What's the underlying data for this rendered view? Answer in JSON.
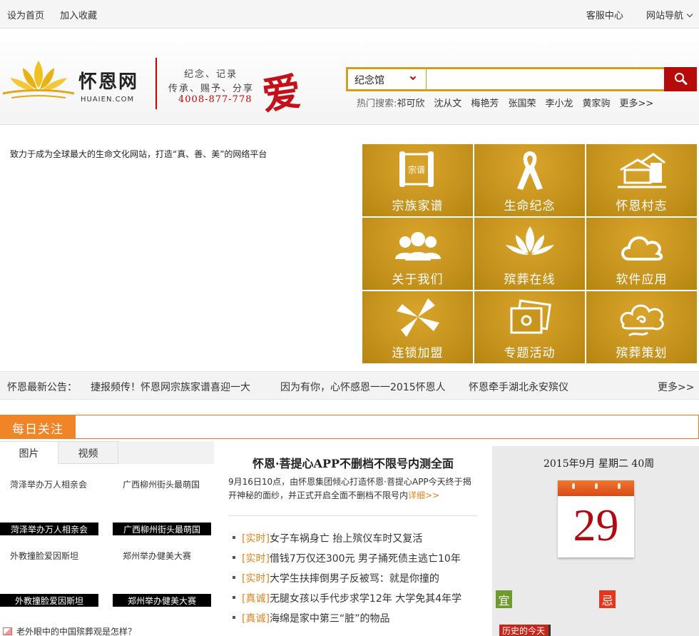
{
  "topbar": {
    "set_home": "设为首页",
    "add_fav": "加入收藏",
    "service": "客服中心",
    "site_nav": "网站导航"
  },
  "header": {
    "logo_cn": "怀恩网",
    "logo_en": "HUAIEN.COM",
    "slogan_line1": "纪念、记录",
    "slogan_line2": "传承、赐予、分享",
    "hotline": "4008-877-778",
    "love_char": "爱"
  },
  "search": {
    "category": "纪念馆",
    "value": "",
    "placeholder": "",
    "hot_label": "热门搜索:",
    "hot_keywords": [
      "祁可欣",
      "沈从文",
      "梅艳芳",
      "张国荣",
      "李小龙",
      "黄家驹",
      "更多>>"
    ]
  },
  "tagline": "致力于成为全球最大的生命文化网站，打造“真、善、美”的网络平台",
  "grid": [
    {
      "label": "宗族家谱",
      "icon": "scroll-icon"
    },
    {
      "label": "生命纪念",
      "icon": "ribbon-icon"
    },
    {
      "label": "怀恩村志",
      "icon": "village-icon"
    },
    {
      "label": "关于我们",
      "icon": "people-icon"
    },
    {
      "label": "殡葬在线",
      "icon": "lotus-icon"
    },
    {
      "label": "软件应用",
      "icon": "cloud-icon"
    },
    {
      "label": "连锁加盟",
      "icon": "pinwheel-icon"
    },
    {
      "label": "专题活动",
      "icon": "photo-icon"
    },
    {
      "label": "殡葬策划",
      "icon": "auspicious-cloud-icon"
    }
  ],
  "notice": {
    "label": "怀恩最新公告：",
    "items": [
      "捷报频传！怀恩网宗族家谱喜迎一大",
      "因为有你，心怀感恩一一2015怀恩人",
      "怀恩牵手湖北永安殡仪"
    ],
    "more": "更多>>"
  },
  "daily": {
    "title": "每日关注"
  },
  "left": {
    "tabs": [
      "图片",
      "视频"
    ],
    "captions": [
      "菏泽举办万人相亲会",
      "广西柳州街头最萌国",
      "外教撞脸爱因斯坦",
      "郑州举办健美大赛"
    ],
    "bars": [
      "菏泽举办万人相亲会",
      "广西柳州街头最萌国",
      "外教撞脸爱因斯坦",
      "郑州举办健美大赛"
    ],
    "link": "老外眼中的中国殡葬观是怎样？"
  },
  "middle": {
    "headline": "怀恩·菩提心APP不删档不限号内测全面",
    "summary": "9月16日10点，由怀恩集团倾心打造怀恩·菩提心APP今天终于揭开神秘的面纱，并正式开启全面不删档不限号内",
    "detail": "详细>>",
    "news": [
      {
        "tag": "[实时]",
        "text": "女子车祸身亡  抬上殡仪车时又复活"
      },
      {
        "tag": "[实时]",
        "text": "借钱7万仅还300元  男子捅死债主逃亡10年"
      },
      {
        "tag": "[实时]",
        "text": "大学生扶摔倒男子反被骂：就是你撞的"
      },
      {
        "tag": "[真诚]",
        "text": "无腿女孩以手代步求学12年  大学免其4年学"
      },
      {
        "tag": "[真诚]",
        "text": "海绵是家中第三“脏”的物品"
      }
    ]
  },
  "right": {
    "date_line": "2015年9月  星期二  40周",
    "day": "29",
    "yi": "宜",
    "ji": "忌",
    "history": "历史的今天"
  },
  "colors": {
    "gold": "#c4921b",
    "orange": "#f08527",
    "red": "#b70a0a"
  }
}
